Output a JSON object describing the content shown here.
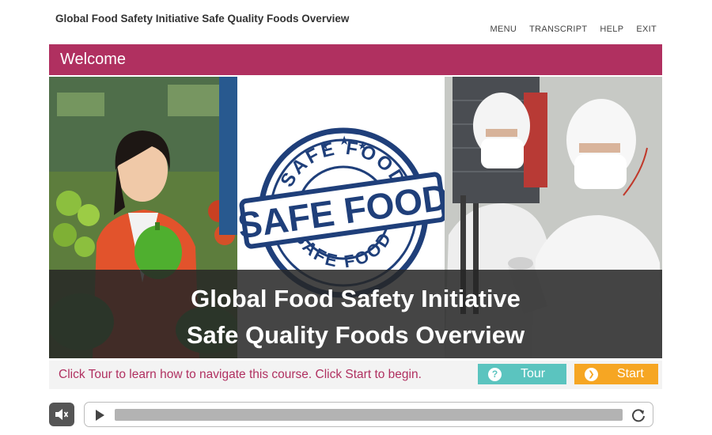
{
  "header": {
    "course_title": "Global Food Safety Initiative Safe Quality Foods Overview",
    "nav": {
      "menu": "MENU",
      "transcript": "TRANSCRIPT",
      "help": "HELP",
      "exit": "EXIT"
    }
  },
  "slide": {
    "title": "Welcome",
    "stamp": {
      "top_arc": "SAFE FOOD",
      "center": "SAFE FOOD",
      "bottom_arc": "SAFE FOOD"
    },
    "overlay_line1": "Global Food Safety Initiative",
    "overlay_line2": "Safe Quality Foods Overview"
  },
  "footer": {
    "instructions": "Click Tour to learn how to navigate this course. Click Start to begin.",
    "tour_label": "Tour",
    "start_label": "Start"
  },
  "player": {
    "mute_icon": "speaker-icon",
    "play_icon": "play-icon",
    "replay_icon": "replay-icon",
    "progress": 0
  },
  "colors": {
    "accent": "#b03060",
    "tour": "#5bc4bf",
    "start": "#f6a623"
  }
}
